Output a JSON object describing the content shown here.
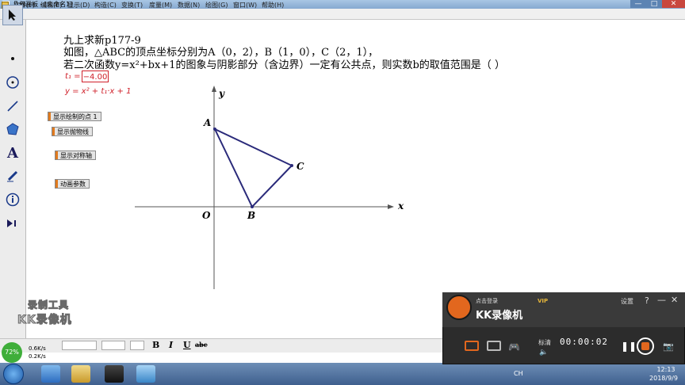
{
  "window": {
    "title": "几何画板 - [未命名1]",
    "buttons": {
      "minimize": "—",
      "maximize": "□",
      "close": "✕"
    }
  },
  "menu": {
    "items": [
      "文件(F)",
      "编辑(E)",
      "显示(D)",
      "构造(C)",
      "变换(T)",
      "度量(M)",
      "数据(N)",
      "绘图(G)",
      "窗口(W)",
      "帮助(H)"
    ]
  },
  "tools": [
    "select-arrow-icon",
    "point-icon",
    "compass-circle-icon",
    "line-icon",
    "polygon-icon",
    "text-icon",
    "marker-icon",
    "info-icon",
    "custom-tool-icon"
  ],
  "problem": {
    "title": "九上求新p177-9",
    "line1": "如图，△ABC的顶点坐标分别为A（0，2），B（1，0），C（2，1），",
    "line2": "若二次函数y=x²+bx+1的图象与阴影部分（含边界）一定有公共点，则实数b的取值范围是（   ）"
  },
  "parameter": {
    "label": "t₁ =",
    "value": "−4.00"
  },
  "function_label": "y = x² + t₁·x + 1",
  "action_buttons": {
    "show_points": "显示绘制的点 1",
    "show_parabola": "显示抛物线",
    "show_axis": "显示对称轴",
    "animate": "动画参数"
  },
  "graph": {
    "x_axis_label": "x",
    "y_axis_label": "y",
    "origin_label": "O",
    "point_labels": {
      "A": "A",
      "B": "B",
      "C": "C"
    },
    "triangle_color": "#2a2a7a"
  },
  "watermark": {
    "line1": "录制工具",
    "line2": "KK录像机"
  },
  "format_bar": {
    "bold": "B",
    "italic": "I",
    "underline": "U",
    "strike": "abc"
  },
  "network": {
    "percent": "72%",
    "up": "0.6K/s",
    "down": "0.2K/s"
  },
  "recorder": {
    "login": "点击登录",
    "vip": "VIP",
    "name": "KK录像机",
    "settings": "设置",
    "help": "?",
    "minimize": "—",
    "close": "✕",
    "quality": "标清",
    "timer": "00:00:02",
    "accent": "#e2671e"
  },
  "taskbar": {
    "lang": "CH",
    "time": "12:13",
    "date": "2018/9/9"
  }
}
